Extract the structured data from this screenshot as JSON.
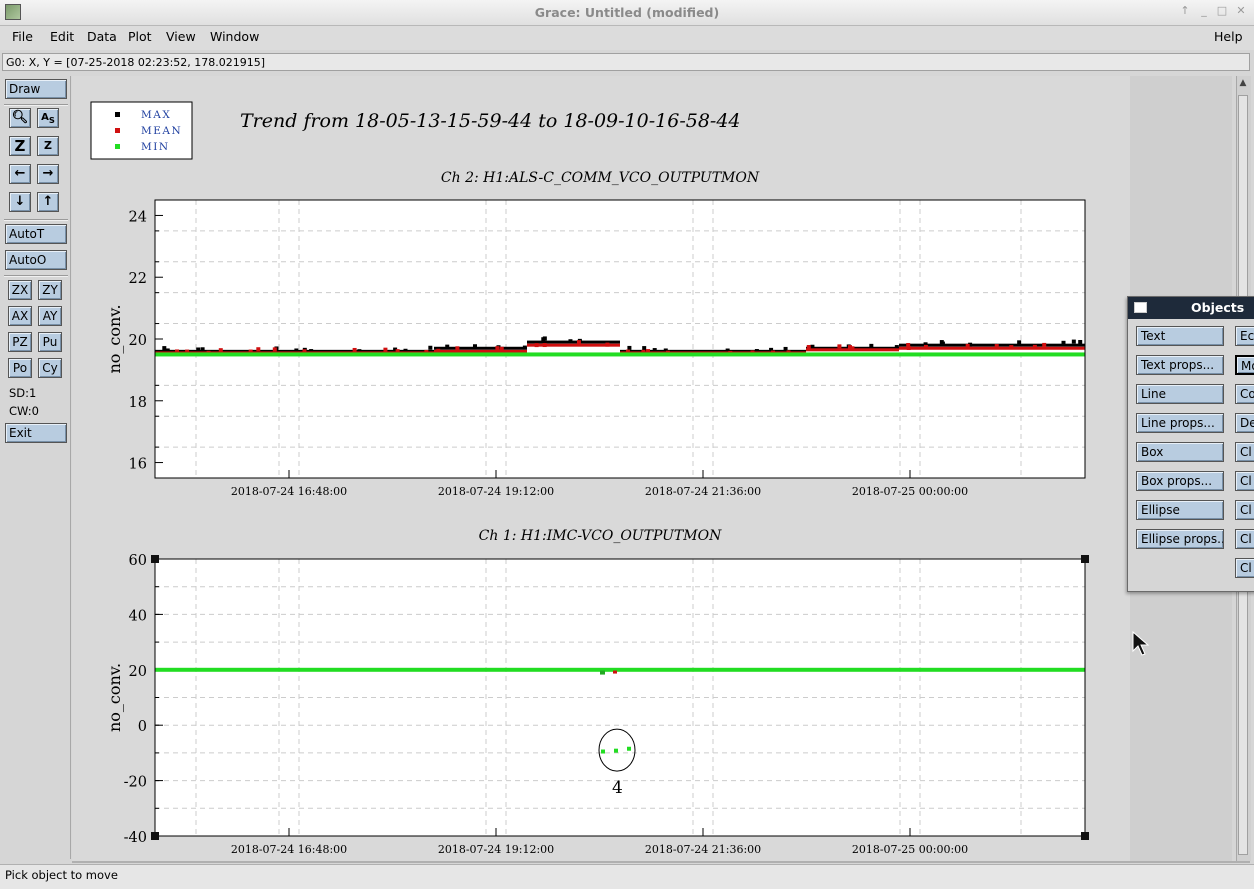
{
  "window": {
    "title": "Grace: Untitled (modified)"
  },
  "menu": {
    "file": "File",
    "edit": "Edit",
    "data": "Data",
    "plot": "Plot",
    "view": "View",
    "window": "Window",
    "help": "Help"
  },
  "locator": {
    "text": "G0: X, Y = [07-25-2018 02:23:52, 178.021915]"
  },
  "toolbar": {
    "draw": "Draw",
    "autot": "AutoT",
    "autoo": "AutoO",
    "zx": "ZX",
    "zy": "ZY",
    "ax": "AX",
    "ay": "AY",
    "pz": "PZ",
    "pu": "Pu",
    "po": "Po",
    "cy": "Cy",
    "sd": "SD:1",
    "cw": "CW:0",
    "exit": "Exit",
    "icons": [
      "zoom-icon",
      "autoscale-icon",
      "zoom-in-icon",
      "zoom-out-icon",
      "left-arrow-icon",
      "right-arrow-icon",
      "down-arrow-icon",
      "up-arrow-icon"
    ]
  },
  "status": {
    "text": "Pick object to move"
  },
  "objects": {
    "title": "Objects",
    "left": [
      "Text",
      "Text props...",
      "Line",
      "Line props...",
      "Box",
      "Box props...",
      "Ellipse",
      "Ellipse props..."
    ],
    "right": [
      "Ec",
      "Mo",
      "Co",
      "De",
      "Cl",
      "Cl",
      "Cl",
      "Cl",
      "Cl"
    ]
  },
  "plot": {
    "title": "Trend from 18-05-13-15-59-44 to 18-09-10-16-58-44",
    "legend": [
      {
        "label": "MAX",
        "color": "#000000"
      },
      {
        "label": "MEAN",
        "color": "#d01010"
      },
      {
        "label": "MIN",
        "color": "#22dd22"
      }
    ],
    "annotation": "4"
  },
  "chart_data": [
    {
      "type": "scatter",
      "title": "Ch 2: H1:ALS-C_COMM_VCO_OUTPUTMON",
      "xlabel": "",
      "ylabel": "no_conv.",
      "ylim": [
        15.5,
        24.5
      ],
      "yticks": [
        16,
        18,
        20,
        22,
        24
      ],
      "xtick_labels": [
        "2018-07-24 16:48:00",
        "2018-07-24 19:12:00",
        "2018-07-24 21:36:00",
        "2018-07-25 00:00:00"
      ],
      "grid": true,
      "series": [
        {
          "name": "MAX",
          "color": "#000000",
          "values": [
            19.6,
            19.6,
            19.6,
            19.7,
            19.9,
            19.6,
            19.6,
            19.7,
            19.8,
            19.8
          ]
        },
        {
          "name": "MEAN",
          "color": "#d01010",
          "values": [
            19.55,
            19.55,
            19.55,
            19.6,
            19.8,
            19.55,
            19.55,
            19.65,
            19.7,
            19.7
          ]
        },
        {
          "name": "MIN",
          "color": "#22dd22",
          "values": [
            19.5,
            19.5,
            19.5,
            19.5,
            19.5,
            19.5,
            19.5,
            19.5,
            19.5,
            19.5
          ]
        }
      ]
    },
    {
      "type": "scatter",
      "title": "Ch 1: H1:IMC-VCO_OUTPUTMON",
      "xlabel": "",
      "ylabel": "no_conv.",
      "ylim": [
        -40,
        60
      ],
      "yticks": [
        -40,
        -20,
        0,
        20,
        40,
        60
      ],
      "xtick_labels": [
        "2018-07-24 16:48:00",
        "2018-07-24 19:12:00",
        "2018-07-24 21:36:00",
        "2018-07-25 00:00:00"
      ],
      "grid": true,
      "series": [
        {
          "name": "MIN",
          "color": "#22dd22",
          "values": [
            20,
            20,
            20,
            20,
            20,
            20,
            20,
            20,
            20,
            20
          ]
        }
      ],
      "outliers": [
        {
          "y": -9.5
        },
        {
          "y": -9.2
        },
        {
          "y": -8.5
        }
      ]
    }
  ]
}
